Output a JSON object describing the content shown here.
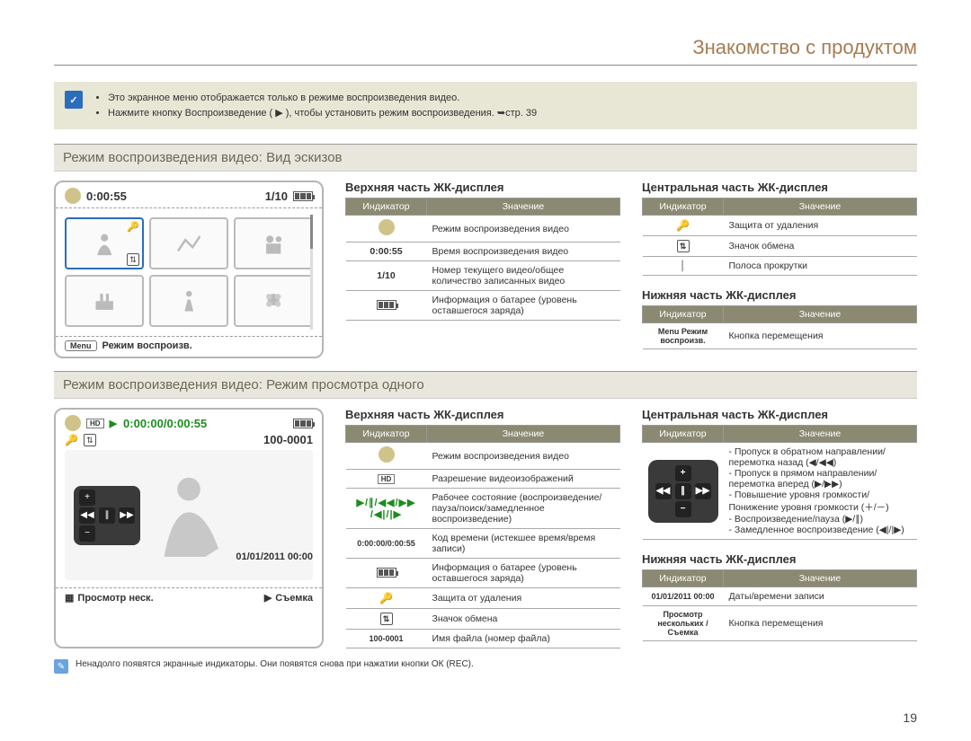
{
  "page_title": "Знакомство с продуктом",
  "notice": {
    "bullets": [
      "Это экранное меню отображается только в режиме воспроизведения видео.",
      "Нажмите кнопку Воспроизведение ( ▶ ), чтобы установить режим воспроизведения. ➥стр. 39"
    ]
  },
  "section1": {
    "heading": "Режим воспроизведения видео: Вид эскизов",
    "lcd": {
      "time": "0:00:55",
      "counter": "1/10",
      "bottom_label": "Режим воспроизв.",
      "menu": "Menu"
    },
    "top_table": {
      "title": "Верхняя часть ЖК-дисплея",
      "headers": [
        "Индикатор",
        "Значение"
      ],
      "rows": [
        {
          "ind": "⬤",
          "val": "Режим воспроизведения видео"
        },
        {
          "ind": "0:00:55",
          "val": "Время воспроизведения видео"
        },
        {
          "ind": "1/10",
          "val": "Номер текущего видео/общее количество записанных видео"
        },
        {
          "ind": "▮▮▮",
          "val": "Информация о батарее (уровень оставшегося заряда)"
        }
      ]
    },
    "center_table": {
      "title": "Центральная часть ЖК-дисплея",
      "headers": [
        "Индикатор",
        "Значение"
      ],
      "rows": [
        {
          "ind": "🔑",
          "val": "Защита от удаления"
        },
        {
          "ind": "⇅",
          "val": "Значок обмена"
        },
        {
          "ind": "│",
          "val": "Полоса прокрутки"
        }
      ]
    },
    "bottom_table": {
      "title": "Нижняя часть ЖК-дисплея",
      "headers": [
        "Индикатор",
        "Значение"
      ],
      "rows": [
        {
          "ind": "Menu Режим воспроизв.",
          "val": "Кнопка перемещения"
        }
      ]
    }
  },
  "section2": {
    "heading": "Режим воспроизведения видео: Режим просмотра одного",
    "lcd": {
      "time": "0:00:00/0:00:55",
      "file_no": "100-0001",
      "datetime": "01/01/2011  00:00",
      "bottom_left": "Просмотр неск.",
      "bottom_right": "Съемка"
    },
    "top_table": {
      "title": "Верхняя часть ЖК-дисплея",
      "headers": [
        "Индикатор",
        "Значение"
      ],
      "rows": [
        {
          "ind": "⬤",
          "val": "Режим воспроизведения видео"
        },
        {
          "ind": "HD",
          "val": "Разрешение видеоизображений"
        },
        {
          "ind": "▶/∥/◀◀/▶▶ / ◀|/|▶",
          "val": "Рабочее состояние (воспроизведение/пауза/поиск/замедленное воспроизведение)"
        },
        {
          "ind": "0:00:00/0:00:55",
          "val": "Код времени (истекшее время/время записи)"
        },
        {
          "ind": "▮▮▮",
          "val": "Информация о батарее (уровень оставшегося заряда)"
        },
        {
          "ind": "🔑",
          "val": "Защита от удаления"
        },
        {
          "ind": "⇅",
          "val": "Значок обмена"
        },
        {
          "ind": "100-0001",
          "val": "Имя файла (номер файла)"
        }
      ]
    },
    "center_table": {
      "title": "Центральная часть ЖК-дисплея",
      "headers": [
        "Индикатор",
        "Значение"
      ],
      "rows": [
        {
          "ind": "+ / ◀◀ ∥ ▶▶ / −",
          "val": "- Пропуск в обратном направлении/перемотка назад (◀/◀◀)\n- Пропуск в прямом направлении/перемотка вперед (▶/▶▶)\n- Повышение уровня громкости/Понижение уровня громкости (＋/－)\n- Воспроизведение/пауза (▶/∥)\n- Замедленное воспроизведение (◀|/|▶)"
        }
      ]
    },
    "bottom_table": {
      "title": "Нижняя часть ЖК-дисплея",
      "headers": [
        "Индикатор",
        "Значение"
      ],
      "rows": [
        {
          "ind": "01/01/2011 00:00",
          "val": "Даты/времени записи"
        },
        {
          "ind": "Просмотр нескольких / Съемка",
          "val": "Кнопка перемещения"
        }
      ]
    }
  },
  "footnote": "Ненадолго появятся экранные индикаторы. Они появятся снова при нажатии кнопки ОК (REC).",
  "page_number": "19"
}
